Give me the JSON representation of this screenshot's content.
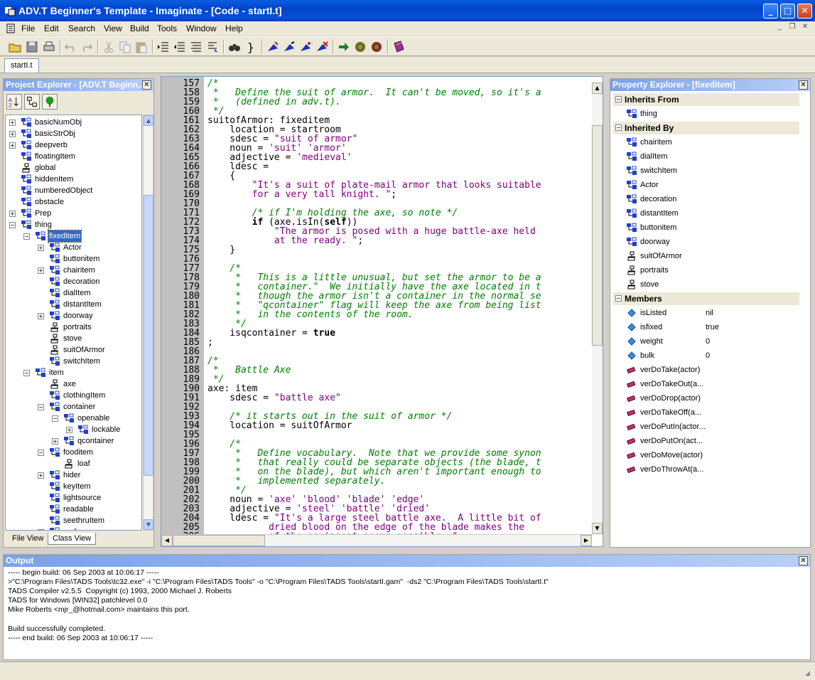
{
  "window": {
    "title": "ADV.T Beginner's Template - Imaginate - [Code - startI.t]",
    "minimize": "_",
    "maximize": "□",
    "close": "✕"
  },
  "menu": [
    "File",
    "Edit",
    "Search",
    "View",
    "Build",
    "Tools",
    "Window",
    "Help"
  ],
  "mdi_buttons": [
    "_",
    "❐",
    "✕"
  ],
  "toolbar_icons": [
    "open-icon",
    "save-icon",
    "print-icon",
    "undo-icon",
    "redo-icon",
    "cut-icon",
    "copy-icon",
    "paste-icon",
    "indent-icon",
    "outdent-icon",
    "align-icon",
    "format-icon",
    "find-icon",
    "brace-match-icon",
    "build-icon",
    "compile-icon",
    "run-icon",
    "debug-icon",
    "goto-icon",
    "tads-icon",
    "tools-icon",
    "book-icon"
  ],
  "document_tab": "startI.t",
  "project_explorer": {
    "title": "Project Explorer - [ADV.T Beginn...",
    "close": "✕",
    "tree": [
      {
        "label": "basicNumObj",
        "indent": 0,
        "exp": "+",
        "icon": "class"
      },
      {
        "label": "basicStrObj",
        "indent": 0,
        "exp": "+",
        "icon": "class"
      },
      {
        "label": "deepverb",
        "indent": 0,
        "exp": "+",
        "icon": "class"
      },
      {
        "label": "floatingItem",
        "indent": 0,
        "exp": "",
        "icon": "class"
      },
      {
        "label": "global",
        "indent": 0,
        "exp": "",
        "icon": "object"
      },
      {
        "label": "hiddenItem",
        "indent": 0,
        "exp": "",
        "icon": "class"
      },
      {
        "label": "numberedObject",
        "indent": 0,
        "exp": "",
        "icon": "class"
      },
      {
        "label": "obstacle",
        "indent": 0,
        "exp": "",
        "icon": "class"
      },
      {
        "label": "Prep",
        "indent": 0,
        "exp": "+",
        "icon": "class"
      },
      {
        "label": "thing",
        "indent": 0,
        "exp": "−",
        "icon": "class"
      },
      {
        "label": "fixeditem",
        "indent": 1,
        "exp": "−",
        "icon": "class",
        "selected": true
      },
      {
        "label": "Actor",
        "indent": 2,
        "exp": "+",
        "icon": "class"
      },
      {
        "label": "buttonitem",
        "indent": 2,
        "exp": "",
        "icon": "class"
      },
      {
        "label": "chairitem",
        "indent": 2,
        "exp": "+",
        "icon": "class"
      },
      {
        "label": "decoration",
        "indent": 2,
        "exp": "",
        "icon": "class"
      },
      {
        "label": "dialItem",
        "indent": 2,
        "exp": "",
        "icon": "class"
      },
      {
        "label": "distantItem",
        "indent": 2,
        "exp": "",
        "icon": "class"
      },
      {
        "label": "doorway",
        "indent": 2,
        "exp": "+",
        "icon": "class"
      },
      {
        "label": "portraits",
        "indent": 2,
        "exp": "",
        "icon": "object"
      },
      {
        "label": "stove",
        "indent": 2,
        "exp": "",
        "icon": "object"
      },
      {
        "label": "suitOfArmor",
        "indent": 2,
        "exp": "",
        "icon": "object"
      },
      {
        "label": "switchItem",
        "indent": 2,
        "exp": "",
        "icon": "class"
      },
      {
        "label": "item",
        "indent": 1,
        "exp": "−",
        "icon": "class"
      },
      {
        "label": "axe",
        "indent": 2,
        "exp": "",
        "icon": "object"
      },
      {
        "label": "clothingItem",
        "indent": 2,
        "exp": "",
        "icon": "class"
      },
      {
        "label": "container",
        "indent": 2,
        "exp": "−",
        "icon": "class"
      },
      {
        "label": "openable",
        "indent": 3,
        "exp": "−",
        "icon": "class"
      },
      {
        "label": "lockable",
        "indent": 4,
        "exp": "+",
        "icon": "class"
      },
      {
        "label": "qcontainer",
        "indent": 3,
        "exp": "+",
        "icon": "class"
      },
      {
        "label": "fooditem",
        "indent": 2,
        "exp": "−",
        "icon": "class"
      },
      {
        "label": "loaf",
        "indent": 3,
        "exp": "",
        "icon": "object"
      },
      {
        "label": "hider",
        "indent": 2,
        "exp": "+",
        "icon": "class"
      },
      {
        "label": "keyItem",
        "indent": 2,
        "exp": "",
        "icon": "class"
      },
      {
        "label": "lightsource",
        "indent": 2,
        "exp": "",
        "icon": "class"
      },
      {
        "label": "readable",
        "indent": 2,
        "exp": "",
        "icon": "class"
      },
      {
        "label": "seethruItem",
        "indent": 2,
        "exp": "",
        "icon": "class"
      },
      {
        "label": "surface",
        "indent": 2,
        "exp": "+",
        "icon": "class"
      }
    ],
    "tabs": [
      "File View",
      "Class View"
    ]
  },
  "editor": {
    "lines": [
      {
        "n": "157",
        "segs": [
          [
            "cm",
            "/*"
          ]
        ]
      },
      {
        "n": "158",
        "segs": [
          [
            "cm",
            " *   Define the suit of armor.  It can't be moved, so it's a"
          ]
        ]
      },
      {
        "n": "159",
        "segs": [
          [
            "cm",
            " *   (defined in adv.t)."
          ]
        ]
      },
      {
        "n": "160",
        "segs": [
          [
            "cm",
            " */"
          ]
        ]
      },
      {
        "n": "161",
        "segs": [
          [
            "",
            "suitofArmor: fixeditem"
          ]
        ]
      },
      {
        "n": "162",
        "segs": [
          [
            "",
            "    location = startroom"
          ]
        ]
      },
      {
        "n": "163",
        "segs": [
          [
            "",
            "    sdesc = "
          ],
          [
            "st",
            "\"suit of armor\""
          ]
        ]
      },
      {
        "n": "164",
        "segs": [
          [
            "",
            "    noun = "
          ],
          [
            "st",
            "'suit' 'armor'"
          ]
        ]
      },
      {
        "n": "165",
        "segs": [
          [
            "",
            "    adjective = "
          ],
          [
            "st",
            "'medieval'"
          ]
        ]
      },
      {
        "n": "166",
        "segs": [
          [
            "",
            "    ldesc ="
          ]
        ]
      },
      {
        "n": "167",
        "segs": [
          [
            "",
            "    {"
          ]
        ]
      },
      {
        "n": "168",
        "segs": [
          [
            "st",
            "        \"It's a suit of plate-mail armor that looks suitable"
          ]
        ]
      },
      {
        "n": "169",
        "segs": [
          [
            "st",
            "        for a very tall knight. \""
          ],
          [
            "",
            ";"
          ]
        ]
      },
      {
        "n": "170",
        "segs": [
          [
            "",
            ""
          ]
        ]
      },
      {
        "n": "171",
        "segs": [
          [
            "cm",
            "        /* if I'm holding the axe, so note */"
          ]
        ]
      },
      {
        "n": "172",
        "segs": [
          [
            "kw",
            "        if"
          ],
          [
            "",
            " (axe.isIn("
          ],
          [
            "kw",
            "self"
          ],
          [
            "",
            "))"
          ]
        ]
      },
      {
        "n": "173",
        "segs": [
          [
            "st",
            "            \"The armor is posed with a huge battle-axe held"
          ]
        ]
      },
      {
        "n": "174",
        "segs": [
          [
            "st",
            "            at the ready. \""
          ],
          [
            "",
            ";"
          ]
        ]
      },
      {
        "n": "175",
        "segs": [
          [
            "",
            "    }"
          ]
        ]
      },
      {
        "n": "176",
        "segs": [
          [
            "",
            ""
          ]
        ]
      },
      {
        "n": "177",
        "segs": [
          [
            "cm",
            "    /*"
          ]
        ]
      },
      {
        "n": "178",
        "segs": [
          [
            "cm",
            "     *   This is a little unusual, but set the armor to be a"
          ]
        ]
      },
      {
        "n": "179",
        "segs": [
          [
            "cm",
            "     *   container.\"  We initially have the axe located in t"
          ]
        ]
      },
      {
        "n": "180",
        "segs": [
          [
            "cm",
            "     *   though the armor isn't a container in the normal se"
          ]
        ]
      },
      {
        "n": "181",
        "segs": [
          [
            "cm",
            "     *   \"qcontainer\" flag will keep the axe from being list"
          ]
        ]
      },
      {
        "n": "182",
        "segs": [
          [
            "cm",
            "     *   in the contents of the room."
          ]
        ]
      },
      {
        "n": "183",
        "segs": [
          [
            "cm",
            "     */"
          ]
        ]
      },
      {
        "n": "184",
        "segs": [
          [
            "",
            "    isqcontainer = "
          ],
          [
            "kw",
            "true"
          ]
        ]
      },
      {
        "n": "185",
        "segs": [
          [
            "",
            ";"
          ]
        ]
      },
      {
        "n": "186",
        "segs": [
          [
            "",
            ""
          ]
        ]
      },
      {
        "n": "187",
        "segs": [
          [
            "cm",
            "/*"
          ]
        ]
      },
      {
        "n": "188",
        "segs": [
          [
            "cm",
            " *   Battle Axe"
          ]
        ]
      },
      {
        "n": "189",
        "segs": [
          [
            "cm",
            " */"
          ]
        ]
      },
      {
        "n": "190",
        "segs": [
          [
            "",
            "axe: item"
          ]
        ]
      },
      {
        "n": "191",
        "segs": [
          [
            "",
            "    sdesc = "
          ],
          [
            "st",
            "\"battle axe\""
          ]
        ]
      },
      {
        "n": "192",
        "segs": [
          [
            "",
            ""
          ]
        ]
      },
      {
        "n": "193",
        "segs": [
          [
            "cm",
            "    /* it starts out in the suit of armor */"
          ]
        ]
      },
      {
        "n": "194",
        "segs": [
          [
            "",
            "    location = suitOfArmor"
          ]
        ]
      },
      {
        "n": "195",
        "segs": [
          [
            "",
            ""
          ]
        ]
      },
      {
        "n": "196",
        "segs": [
          [
            "cm",
            "    /*"
          ]
        ]
      },
      {
        "n": "197",
        "segs": [
          [
            "cm",
            "     *   Define vocabulary.  Note that we provide some synon"
          ]
        ]
      },
      {
        "n": "198",
        "segs": [
          [
            "cm",
            "     *   that really could be separate objects (the blade, t"
          ]
        ]
      },
      {
        "n": "199",
        "segs": [
          [
            "cm",
            "     *   on the blade), but which aren't important enough to"
          ]
        ]
      },
      {
        "n": "200",
        "segs": [
          [
            "cm",
            "     *   implemented separately."
          ]
        ]
      },
      {
        "n": "201",
        "segs": [
          [
            "cm",
            "     */"
          ]
        ]
      },
      {
        "n": "202",
        "segs": [
          [
            "",
            "    noun = "
          ],
          [
            "st",
            "'axe' 'blood' 'blade' 'edge'"
          ]
        ]
      },
      {
        "n": "203",
        "segs": [
          [
            "",
            "    adjective = "
          ],
          [
            "st",
            "'steel' 'battle' 'dried'"
          ]
        ]
      },
      {
        "n": "204",
        "segs": [
          [
            "",
            "    ldesc = "
          ],
          [
            "st",
            "\"It's a large steel battle axe.  A little bit of"
          ]
        ]
      },
      {
        "n": "205",
        "segs": [
          [
            "st",
            "           dried blood on the edge of the blade makes the"
          ]
        ]
      },
      {
        "n": "206",
        "segs": [
          [
            "st",
            "           of the equipment seems possible. \""
          ]
        ]
      }
    ]
  },
  "property_explorer": {
    "title": "Property Explorer - [fixeditem]",
    "close": "✕",
    "sections": [
      {
        "label": "Inherits From",
        "toggle": "−",
        "rows": [
          {
            "name": "thing",
            "value": "",
            "icon": "class"
          }
        ]
      },
      {
        "label": "Inherited By",
        "toggle": "−",
        "rows": [
          {
            "name": "chairitem",
            "value": "",
            "icon": "class"
          },
          {
            "name": "dialItem",
            "value": "",
            "icon": "class"
          },
          {
            "name": "switchItem",
            "value": "",
            "icon": "class"
          },
          {
            "name": "Actor",
            "value": "",
            "icon": "class"
          },
          {
            "name": "decoration",
            "value": "",
            "icon": "class"
          },
          {
            "name": "distantItem",
            "value": "",
            "icon": "class"
          },
          {
            "name": "buttonitem",
            "value": "",
            "icon": "class"
          },
          {
            "name": "doorway",
            "value": "",
            "icon": "class"
          },
          {
            "name": "suitOfArmor",
            "value": "",
            "icon": "object"
          },
          {
            "name": "portraits",
            "value": "",
            "icon": "object"
          },
          {
            "name": "stove",
            "value": "",
            "icon": "object"
          }
        ]
      },
      {
        "label": "Members",
        "toggle": "−",
        "rows": [
          {
            "name": "isListed",
            "value": "nil",
            "icon": "prop"
          },
          {
            "name": "isfixed",
            "value": "true",
            "icon": "prop"
          },
          {
            "name": "weight",
            "value": "0",
            "icon": "prop"
          },
          {
            "name": "bulk",
            "value": "0",
            "icon": "prop"
          },
          {
            "name": "verDoTake(actor)",
            "value": "",
            "icon": "method"
          },
          {
            "name": "verDoTakeOut(a...",
            "value": "",
            "icon": "method"
          },
          {
            "name": "verDoDrop(actor)",
            "value": "",
            "icon": "method"
          },
          {
            "name": "verDoTakeOff(a...",
            "value": "",
            "icon": "method"
          },
          {
            "name": "verDoPutIn(actor...",
            "value": "",
            "icon": "method"
          },
          {
            "name": "verDoPutOn(act...",
            "value": "",
            "icon": "method"
          },
          {
            "name": "verDoMove(actor)",
            "value": "",
            "icon": "method"
          },
          {
            "name": "verDoThrowAt(a...",
            "value": "",
            "icon": "method"
          }
        ]
      }
    ]
  },
  "output": {
    "title": "Output",
    "close": "✕",
    "lines": [
      "----- begin build: 06 Sep 2003 at 10:06:17 -----",
      ">\"C:\\Program Files\\TADS Tools\\tc32.exe\" -i \"C:\\Program Files\\TADS Tools\" -o \"C:\\Program Files\\TADS Tools\\startI.gam\"  -ds2 \"C:\\Program Files\\TADS Tools\\startI.t\"",
      "TADS Compiler v2.5.5  Copyright (c) 1993, 2000 Michael J. Roberts",
      "TADS for Windows [WIN32] patchlevel 0.0",
      "Mike Roberts <mjr_@hotmail.com> maintains this port.",
      "",
      "Build successfully completed.",
      "----- end build: 06 Sep 2003 at 10:06:17 -----"
    ]
  }
}
